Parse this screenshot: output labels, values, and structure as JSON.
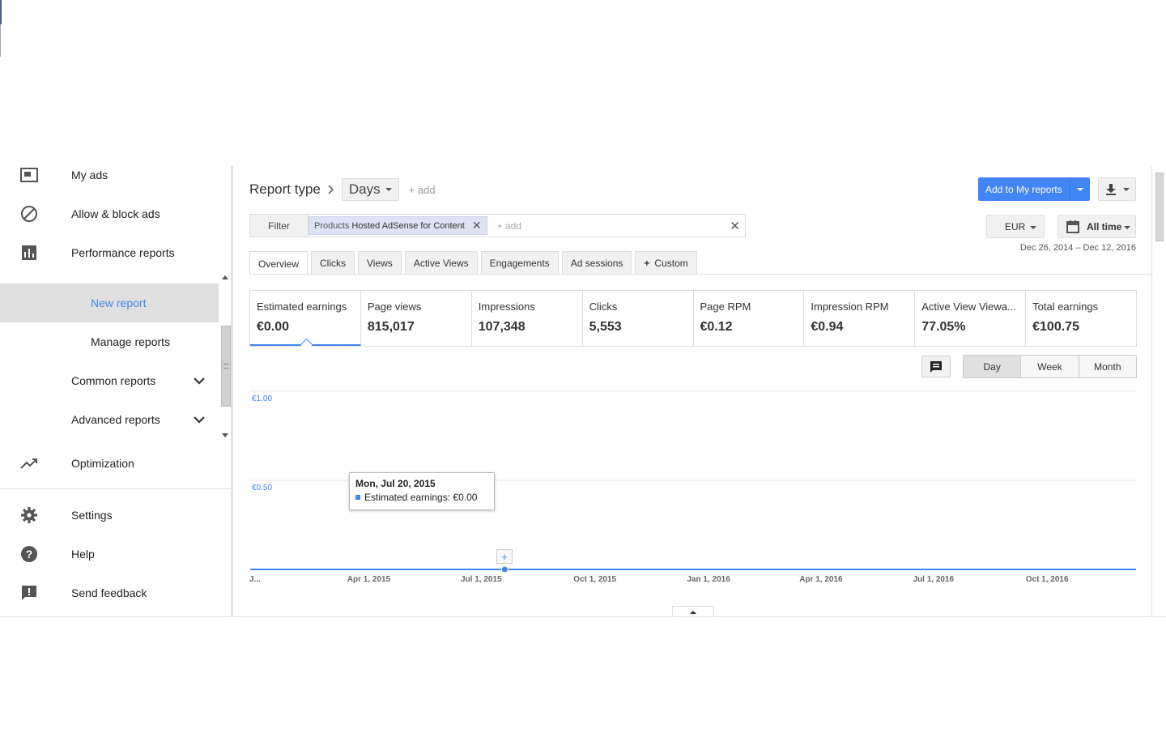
{
  "sidebar": {
    "items": [
      {
        "label": "My ads",
        "icon": "my-ads-icon"
      },
      {
        "label": "Allow & block ads",
        "icon": "block-icon"
      },
      {
        "label": "Performance reports",
        "icon": "bar-chart-icon"
      }
    ],
    "sub_items": [
      {
        "label": "New report",
        "active": true
      },
      {
        "label": "Manage reports",
        "active": false
      },
      {
        "label": "Common reports"
      },
      {
        "label": "Advanced reports"
      }
    ],
    "optimization": {
      "label": "Optimization",
      "icon": "trending-up-icon"
    },
    "footer_items": [
      {
        "label": "Settings",
        "icon": "gear-icon"
      },
      {
        "label": "Help",
        "icon": "help-icon"
      },
      {
        "label": "Send feedback",
        "icon": "feedback-icon"
      }
    ]
  },
  "report": {
    "type_label": "Report type",
    "dimension": "Days",
    "add_label": "+ add",
    "add_to_my_reports": "Add to My reports"
  },
  "filter": {
    "label": "Filter",
    "chip_key": "Products",
    "chip_value": "Hosted AdSense for Content",
    "add_placeholder": "+ add"
  },
  "currency": "EUR",
  "time_range": "All time",
  "date_range": "Dec 26, 2014 – Dec 12, 2016",
  "tabs": [
    {
      "label": "Overview",
      "active": true
    },
    {
      "label": "Clicks"
    },
    {
      "label": "Views"
    },
    {
      "label": "Active Views"
    },
    {
      "label": "Engagements"
    },
    {
      "label": "Ad sessions"
    },
    {
      "label": "Custom"
    }
  ],
  "scorecards": [
    {
      "label": "Estimated earnings",
      "value": "€0.00",
      "active": true
    },
    {
      "label": "Page views",
      "value": "815,017"
    },
    {
      "label": "Impressions",
      "value": "107,348"
    },
    {
      "label": "Clicks",
      "value": "5,553"
    },
    {
      "label": "Page RPM",
      "value": "€0.12"
    },
    {
      "label": "Impression RPM",
      "value": "€0.94"
    },
    {
      "label": "Active View Viewa...",
      "value": "77.05%"
    },
    {
      "label": "Total earnings",
      "value": "€100.75"
    }
  ],
  "granularity": [
    {
      "label": "Day",
      "active": true
    },
    {
      "label": "Week"
    },
    {
      "label": "Month"
    }
  ],
  "tooltip": {
    "date": "Mon, Jul 20, 2015",
    "text": "Estimated earnings: €0.00"
  },
  "colors": {
    "accent": "#4285f4",
    "active_bg": "#e0e0e0",
    "border": "#dddddd"
  },
  "chart_data": {
    "type": "line",
    "x_start": "2014-12-26",
    "x_end": "2016-12-12",
    "ylim": [
      0,
      1.0
    ],
    "y_ticks": [
      {
        "value": 1.0,
        "label": "€1.00"
      },
      {
        "value": 0.5,
        "label": "€0.50"
      }
    ],
    "x_ticks": [
      {
        "date": "2014-12-26",
        "label": "J..."
      },
      {
        "date": "2015-04-01",
        "label": "Apr 1, 2015"
      },
      {
        "date": "2015-07-01",
        "label": "Jul 1, 2015"
      },
      {
        "date": "2015-10-01",
        "label": "Oct 1, 2015"
      },
      {
        "date": "2016-01-01",
        "label": "Jan 1, 2016"
      },
      {
        "date": "2016-04-01",
        "label": "Apr 1, 2016"
      },
      {
        "date": "2016-07-01",
        "label": "Jul 1, 2016"
      },
      {
        "date": "2016-10-01",
        "label": "Oct 1, 2016"
      }
    ],
    "series": [
      {
        "name": "Estimated earnings",
        "color": "#4285f4",
        "points": [
          [
            "2014-12-26",
            0.0
          ],
          [
            "2016-12-12",
            0.0
          ]
        ]
      }
    ],
    "highlight": {
      "date": "2015-07-20",
      "value": 0.0
    }
  }
}
